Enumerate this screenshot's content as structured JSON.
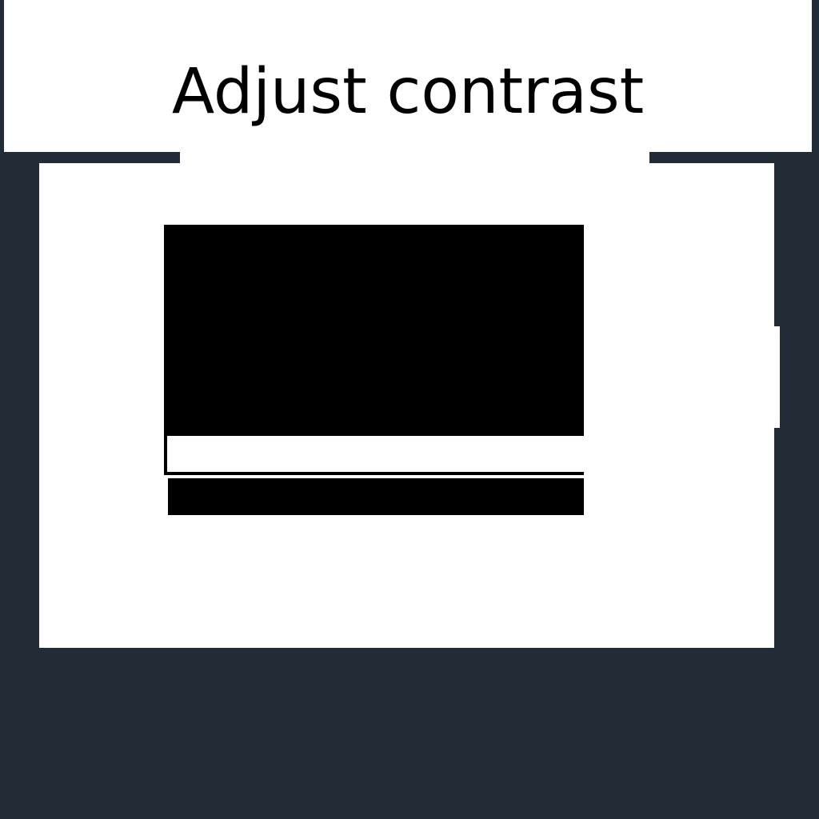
{
  "dialog": {
    "title": "Adjust contrast"
  },
  "colors": {
    "background": "#222c37",
    "panel": "#ffffff",
    "preview": "#000000",
    "text": "#000000"
  },
  "contrast_slider": {
    "fill_fraction": 1.0
  }
}
